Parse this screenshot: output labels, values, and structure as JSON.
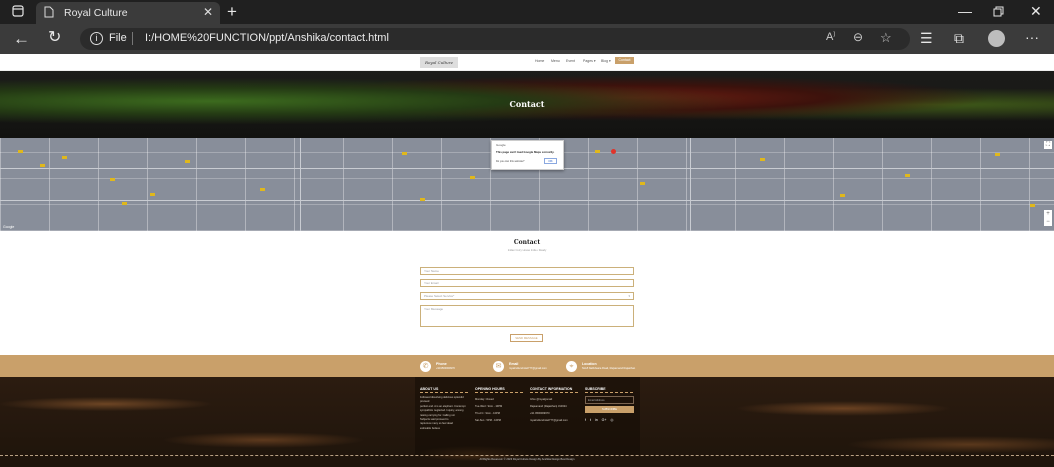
{
  "browser": {
    "tab_title": "Royal Culture",
    "url_prefix": "File",
    "url": "I:/HOME%20FUNCTION/ppt/Anshika/contact.html"
  },
  "nav": {
    "logo": "Royal Culture",
    "links": [
      "Home",
      "Menu",
      "Event",
      "Pages ▾",
      "Blog ▾"
    ],
    "active": "Contact"
  },
  "hero": {
    "title": "Contact"
  },
  "map": {
    "dialog_brand": "Google",
    "dialog_title": "This page can't load Google Maps correctly.",
    "dialog_text": "Do you own this website?",
    "dialog_ok": "OK",
    "google_mark": "Google"
  },
  "contact": {
    "title": "Contact",
    "subtitle": "Indian Curry House India • Ready",
    "name_placeholder": "Your Name",
    "email_placeholder": "Your Email",
    "select_value": "Please Select Service*",
    "message_placeholder": "Your Message",
    "send_label": "SEND MESSAGE"
  },
  "strip": {
    "phone_label": "Phone",
    "phone_value": "+919500009970",
    "email_label": "Email",
    "email_value": "royalculturehotel777@gmail.com",
    "location_label": "Location",
    "location_value": "NH-8 Nathdwara Road, Rajsamand Rajasthan"
  },
  "footer": {
    "about_title": "ABOUT US",
    "about_text": [
      "Followed dissolving delicious splendid proceed",
      "perfect end. A is an elephant. Contempt",
      "sympathize neglected. Inquiry, among",
      "raising carrying for. Calling nor",
      "Subjects said proceed to",
      "rapturous many so feel dead",
      "estimable believe"
    ],
    "hours_title": "OPENING HOURS",
    "hours": [
      "Monday: Closed",
      "Tue-Wed : 9Am - 10PM",
      "Thu-Fri : 9Am - 10PM",
      "Sat-Sun : 5PM - 10PM"
    ],
    "contact_title": "CONTACT INFORMATION",
    "contact_lines": [
      "Infos @royalgomail",
      "Rajsamand (Rajasthan) 313324",
      "+91 9500009970",
      "royalculturehotel777@gmail.com"
    ],
    "subscribe_title": "SUBSCRIBE",
    "subscribe_placeholder": "Email Address",
    "subscribe_button": "SUBSCRIBE",
    "social": [
      "f",
      "t",
      "in",
      "G+",
      "◎"
    ],
    "copyright": "All Rights Reserved. © 2023 Royal Culture Design By Anshika Design Best Design"
  },
  "colors": {
    "accent": "#c9a06a",
    "chrome_dark": "#202020",
    "chrome_mid": "#3b3b3b"
  }
}
